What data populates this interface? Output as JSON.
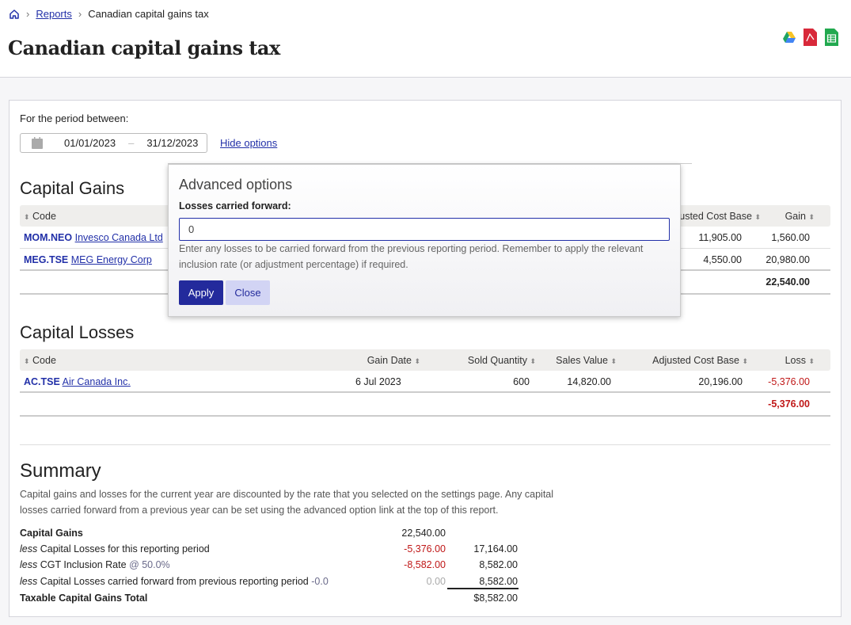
{
  "breadcrumb": {
    "home_icon": "home-icon",
    "reports": "Reports",
    "current": "Canadian capital gains tax"
  },
  "page_title": "Canadian capital gains tax",
  "exports": [
    "google-drive-icon",
    "pdf-icon",
    "spreadsheet-icon"
  ],
  "period": {
    "label": "For the period between:",
    "from": "01/01/2023",
    "to": "31/12/2023",
    "dash": "–",
    "hide_options": "Hide options"
  },
  "gains": {
    "title": "Capital Gains",
    "headers": {
      "code": "Code",
      "acb": "Adjusted Cost Base",
      "gain": "Gain"
    },
    "rows": [
      {
        "code": "MOM.NEO",
        "name": "Invesco Canada Ltd",
        "acb": "11,905.00",
        "gain": "1,560.00"
      },
      {
        "code": "MEG.TSE",
        "name": "MEG Energy Corp",
        "acb": "4,550.00",
        "gain": "20,980.00"
      }
    ],
    "total": "22,540.00"
  },
  "losses": {
    "title": "Capital Losses",
    "headers": {
      "code": "Code",
      "date": "Gain Date",
      "qty": "Sold Quantity",
      "sales": "Sales Value",
      "acb": "Adjusted Cost Base",
      "loss": "Loss"
    },
    "rows": [
      {
        "code": "AC.TSE",
        "name": "Air Canada Inc.",
        "date": "6 Jul 2023",
        "qty": "600",
        "sales": "14,820.00",
        "acb": "20,196.00",
        "loss": "-5,376.00"
      }
    ],
    "total": "-5,376.00"
  },
  "summary": {
    "title": "Summary",
    "description": "Capital gains and losses for the current year are discounted by the rate that you selected on the settings page. Any capital losses carried forward from a previous year can be set using the advanced option link at the top of this report.",
    "less": "less",
    "capital_gains": {
      "label": "Capital Gains",
      "value": "22,540.00"
    },
    "losses_period": {
      "label": "Capital Losses for this reporting period",
      "value": "-5,376.00",
      "running": "17,164.00"
    },
    "inclusion": {
      "label": "CGT Inclusion Rate",
      "rate": "@ 50.0%",
      "value": "-8,582.00",
      "running": "8,582.00"
    },
    "carried": {
      "label": "Capital Losses carried forward from previous reporting period",
      "rate": "-0.0",
      "value": "0.00",
      "running": "8,582.00"
    },
    "total": {
      "label": "Taxable Capital Gains Total",
      "value": "$8,582.00"
    }
  },
  "advanced": {
    "title": "Advanced options",
    "field_label": "Losses carried forward:",
    "value": "0",
    "help": "Enter any losses to be carried forward from the previous reporting period. Remember to apply the relevant inclusion rate (or adjustment percentage) if required.",
    "apply": "Apply",
    "close": "Close"
  },
  "colors": {
    "link": "#2230a8",
    "negative": "#c01818",
    "apply_bg": "#232a9c",
    "close_bg": "#d2d4f4"
  }
}
